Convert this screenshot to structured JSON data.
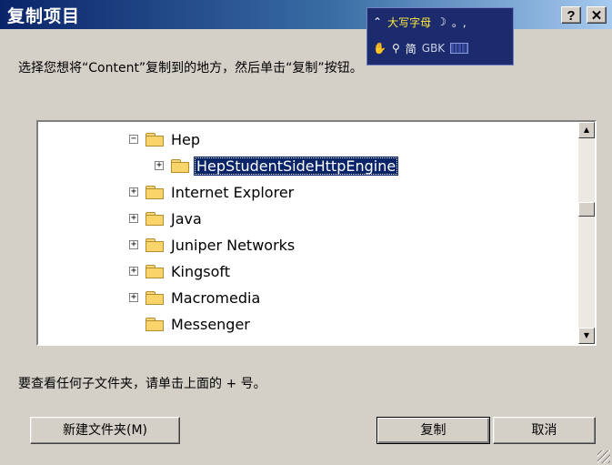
{
  "window": {
    "title": "复制项目",
    "help_label": "?",
    "close_label": "✕"
  },
  "ime": {
    "case_mode": "大写字母",
    "punct": "。,",
    "charset_mode": "简",
    "encoding": "GBK"
  },
  "instruction": "选择您想将“Content”复制到的地方，然后单击“复制”按钮。",
  "tree": {
    "items": [
      {
        "label": "Hep",
        "expander": "−",
        "level": 0,
        "selected": false
      },
      {
        "label": "HepStudentSideHttpEngine",
        "expander": "+",
        "level": 1,
        "selected": true
      },
      {
        "label": "Internet Explorer",
        "expander": "+",
        "level": 0,
        "selected": false
      },
      {
        "label": "Java",
        "expander": "+",
        "level": 0,
        "selected": false
      },
      {
        "label": "Juniper Networks",
        "expander": "+",
        "level": 0,
        "selected": false
      },
      {
        "label": "Kingsoft",
        "expander": "+",
        "level": 0,
        "selected": false
      },
      {
        "label": "Macromedia",
        "expander": "+",
        "level": 0,
        "selected": false
      },
      {
        "label": "Messenger",
        "expander": "",
        "level": 0,
        "selected": false
      }
    ]
  },
  "tip": "要查看任何子文件夹，请单击上面的 + 号。",
  "buttons": {
    "new_folder": "新建文件夹(M)",
    "copy": "复制",
    "cancel": "取消"
  },
  "colors": {
    "titlebar_start": "#0a246a",
    "selection": "#0a246a",
    "dialog_bg": "#d4d0c8"
  }
}
